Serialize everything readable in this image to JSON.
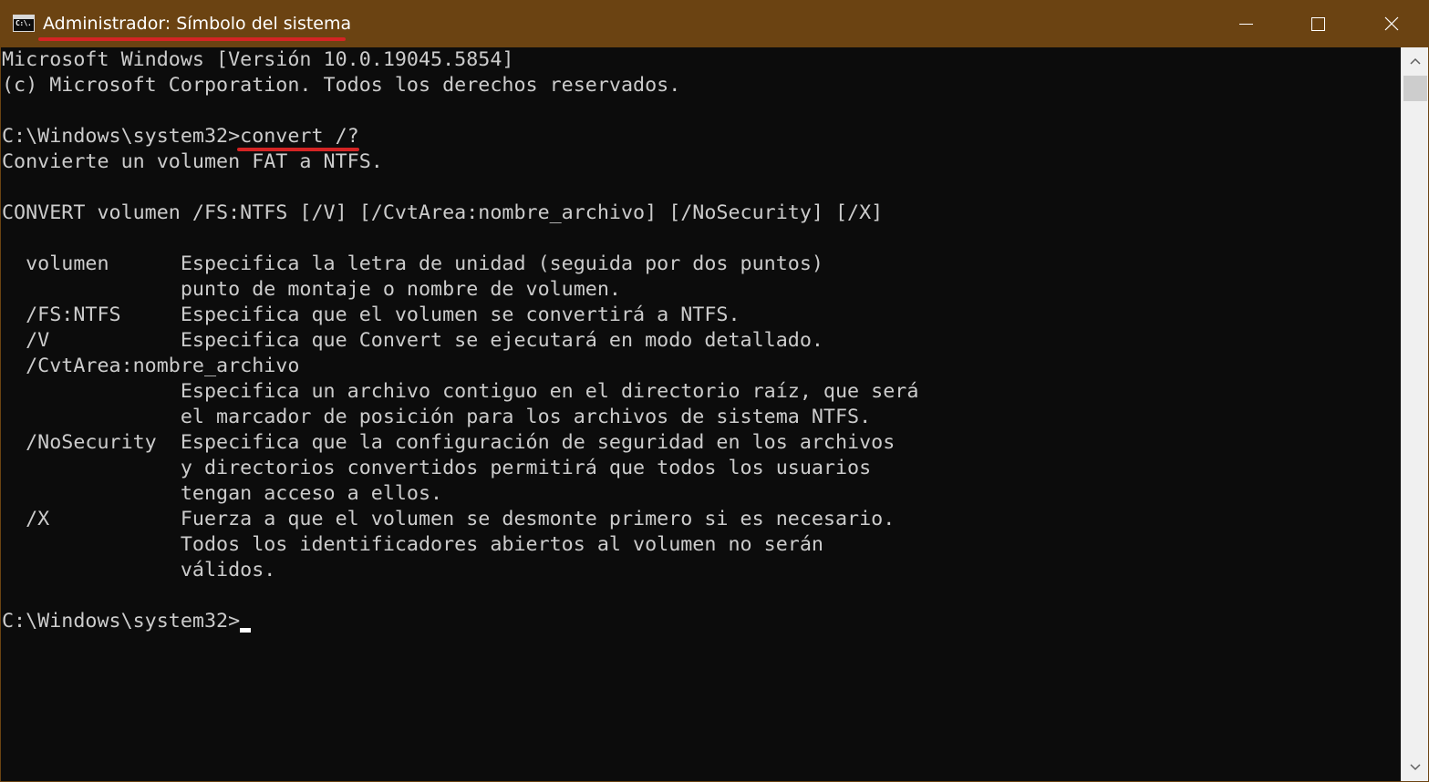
{
  "window": {
    "title": "Administrador: Símbolo del sistema",
    "icon": "cmd-icon",
    "icon_glyph": "C:\\.",
    "controls": {
      "minimize": "minimize-icon",
      "maximize": "maximize-icon",
      "close": "close-icon"
    },
    "colors": {
      "titlebar": "#6b4312",
      "console_bg": "#0c0c0c",
      "console_text": "#cccccc",
      "highlight_underline": "#d42424"
    }
  },
  "console": {
    "lines": [
      "Microsoft Windows [Versión 10.0.19045.5854]",
      "(c) Microsoft Corporation. Todos los derechos reservados.",
      "",
      "C:\\Windows\\system32>convert /?",
      "Convierte un volumen FAT a NTFS.",
      "",
      "CONVERT volumen /FS:NTFS [/V] [/CvtArea:nombre_archivo] [/NoSecurity] [/X]",
      "",
      "  volumen      Especifica la letra de unidad (seguida por dos puntos)",
      "               punto de montaje o nombre de volumen.",
      "  /FS:NTFS     Especifica que el volumen se convertirá a NTFS.",
      "  /V           Especifica que Convert se ejecutará en modo detallado.",
      "  /CvtArea:nombre_archivo",
      "               Especifica un archivo contiguo en el directorio raíz, que será",
      "               el marcador de posición para los archivos de sistema NTFS.",
      "  /NoSecurity  Especifica que la configuración de seguridad en los archivos",
      "               y directorios convertidos permitirá que todos los usuarios",
      "               tengan acceso a ellos.",
      "  /X           Fuerza a que el volumen se desmonte primero si es necesario.",
      "               Todos los identificadores abiertos al volumen no serán",
      "               válidos.",
      "",
      "C:\\Windows\\system32>"
    ]
  },
  "scrollbar": {
    "up_icon": "scroll-up-arrow-icon",
    "down_icon": "scroll-down-arrow-icon"
  }
}
